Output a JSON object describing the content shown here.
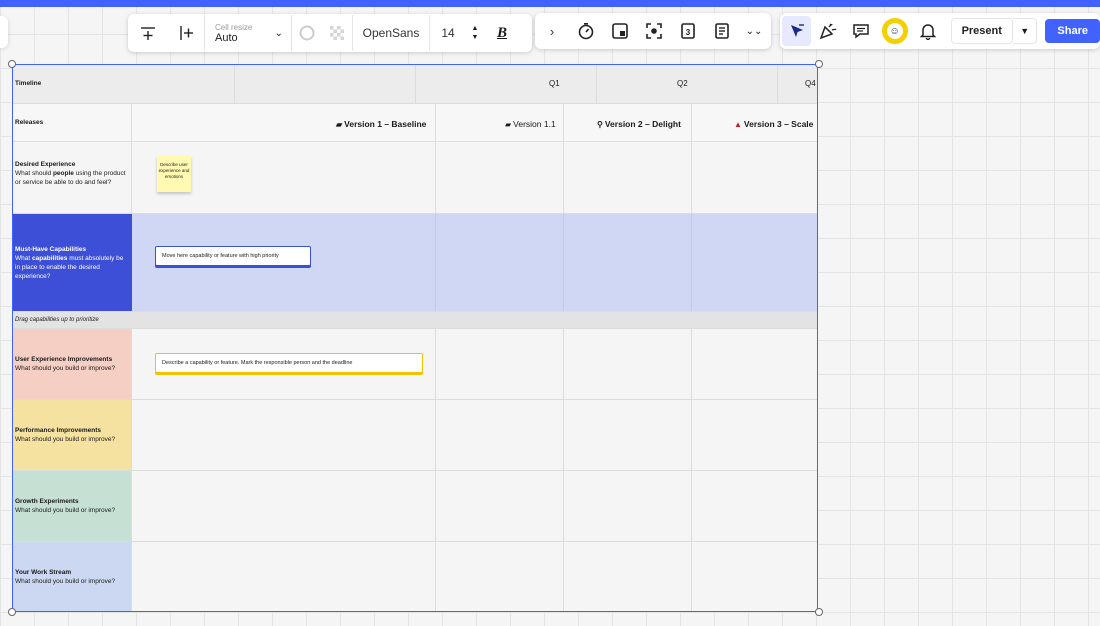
{
  "toolbar": {
    "cell_resize_label": "Cell resize",
    "cell_resize_value": "Auto",
    "font_name": "OpenSans",
    "font_size": "14",
    "bold_glyph": "B"
  },
  "header": {
    "present_label": "Present",
    "share_label": "Share"
  },
  "board": {
    "timeline_label": "Timeline",
    "quarters": [
      "Q1",
      "Q2",
      "Q4"
    ],
    "releases_label": "Releases",
    "releases": [
      {
        "icon": "skateboard-icon",
        "label": "Version 1 – Baseline"
      },
      {
        "icon": "skateboard-icon",
        "label": "Version 1.1"
      },
      {
        "icon": "bicycle-icon",
        "label": "Version 2 – Delight"
      },
      {
        "icon": "car-icon",
        "label": "Version 3 – Scale"
      }
    ],
    "desired": {
      "title": "Desired Experience",
      "desc_pre": "What should ",
      "desc_bold": "people",
      "desc_post": " using the product or service be able to do and feel?",
      "sticky": "Describe user experience and emotions"
    },
    "must_have": {
      "title": "Must-Have Capabilities",
      "desc_pre": "What ",
      "desc_bold": "capabilities",
      "desc_post": " must absolutely be in place to enable the desired experience?",
      "card": "Move here capability or feature with high priority"
    },
    "drag_note": "Drag capabilities up to prioritize",
    "ux": {
      "title": "User Experience Improvements",
      "desc": "What should you build or improve?",
      "card": "Describe a capability or feature. Mark the responsible person and the deadline"
    },
    "perf": {
      "title": "Performance Improvements",
      "desc": "What should you build or improve?"
    },
    "growth": {
      "title": "Growth Experiments",
      "desc": "What should you build or improve?"
    },
    "work": {
      "title": "Your Work Stream",
      "desc": "What should you build or improve?"
    },
    "colors": {
      "accent": "#4262ff",
      "must_have_label": "#3d4fd6",
      "must_have_band": "#d0d7f5",
      "ux": "#f5cfc4",
      "perf": "#f5e1a0",
      "growth": "#c6e0d4",
      "work": "#ccd7f2"
    }
  }
}
